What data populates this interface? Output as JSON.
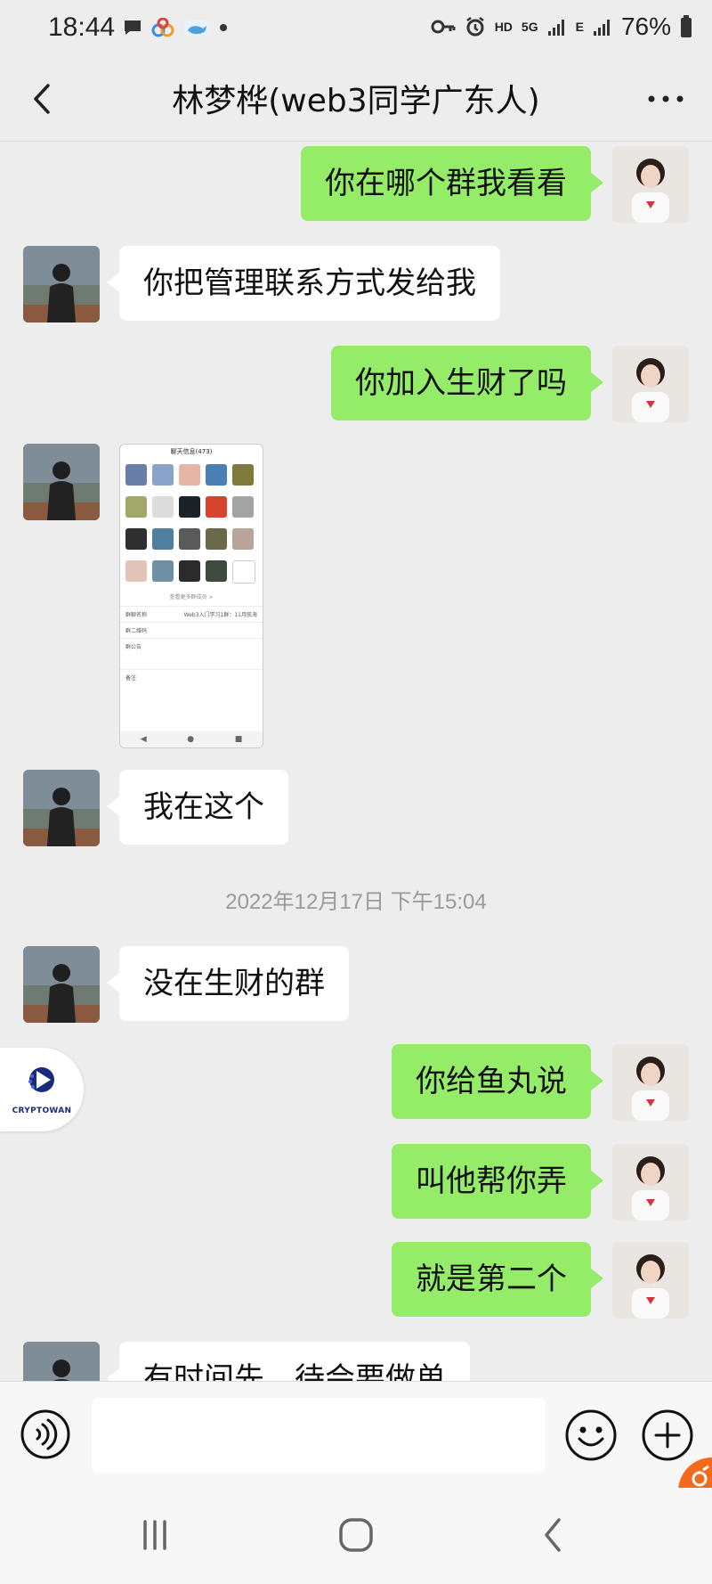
{
  "status_bar": {
    "time": "18:44",
    "network_hd": "HD",
    "network_5g": "5G",
    "network_e": "E",
    "battery": "76%"
  },
  "header": {
    "title": "林梦桦(web3同学广东人)",
    "back_icon": "chevron-left-icon",
    "more_icon": "more-dots-icon"
  },
  "messages": [
    {
      "side": "me",
      "text": "你在哪个群我看看"
    },
    {
      "side": "them",
      "text": "你把管理联系方式发给我"
    },
    {
      "side": "me",
      "text": "你加入生财了吗"
    },
    {
      "side": "them",
      "type": "image"
    },
    {
      "side": "them",
      "text": "我在这个"
    },
    {
      "side": "them",
      "text": "没在生财的群"
    },
    {
      "side": "me",
      "text": "你给鱼丸说"
    },
    {
      "side": "me",
      "text": "叫他帮你弄"
    },
    {
      "side": "me",
      "text": "就是第二个"
    },
    {
      "side": "them",
      "text": "有时间先，待会要做单"
    }
  ],
  "timestamp": "2022年12月17日 下午15:04",
  "shared_screenshot": {
    "title": "聊天信息(473)",
    "more_members": "查看更多群成员 >",
    "rows": [
      {
        "label": "群聊名称",
        "value": "Web3入门学习1群：11月航海"
      },
      {
        "label": "群二维码",
        "value": ""
      },
      {
        "label": "群公告",
        "value": ""
      },
      {
        "label": "备注",
        "value": ""
      }
    ]
  },
  "floating_badge": {
    "label": "CRYPTOWAN"
  },
  "input_bar": {
    "placeholder": "",
    "voice_icon": "voice-icon",
    "emoji_icon": "emoji-icon",
    "plus_icon": "plus-icon"
  },
  "colors": {
    "my_bubble": "#95ec69",
    "their_bubble": "#ffffff",
    "background": "#ededed"
  }
}
